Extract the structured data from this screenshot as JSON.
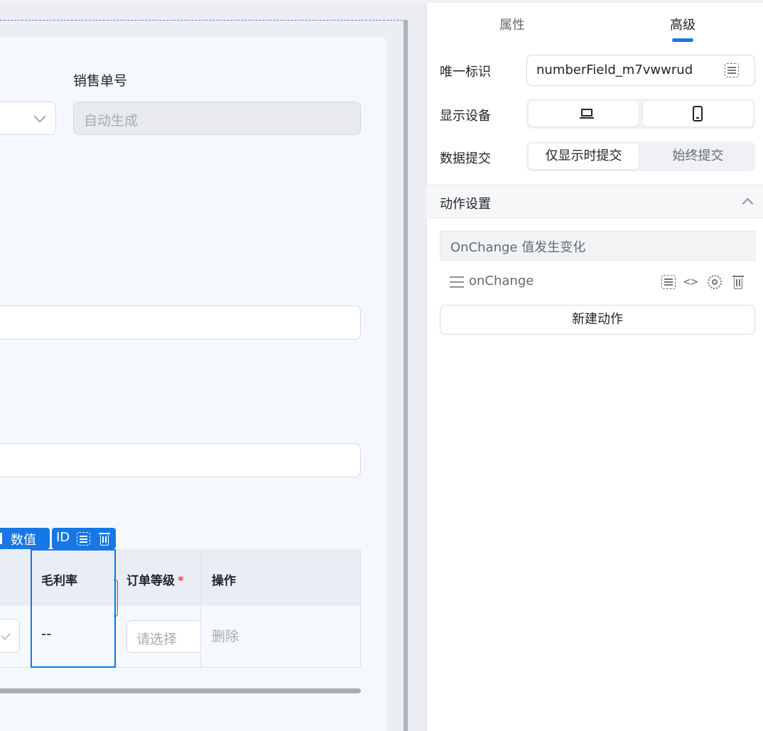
{
  "canvas": {
    "sale_no_label": "销售单号",
    "sale_no_placeholder": "自动生成",
    "component_tag": "数值",
    "component_id_label": "ID",
    "table": {
      "headers": [
        "毛利率",
        "订单等级",
        "操作"
      ],
      "required_mark": "*",
      "row": {
        "gross_margin": "--",
        "order_level_placeholder": "请选择",
        "action": "删除"
      }
    }
  },
  "panel": {
    "tabs": [
      "属性",
      "高级"
    ],
    "active_tab": "高级",
    "unique_id_label": "唯一标识",
    "unique_id_value": "numberField_m7vwwrud",
    "display_device_label": "显示设备",
    "devices": [
      "laptop-icon",
      "phone-icon"
    ],
    "data_submit_label": "数据提交",
    "submit_options": [
      "仅显示时提交",
      "始终提交"
    ],
    "submit_selected": "仅显示时提交",
    "action_section_title": "动作设置",
    "event_name": "OnChange 值发生变化",
    "action_name": "onChange",
    "code_symbol": "<>",
    "new_action_label": "新建动作"
  },
  "colors": {
    "accent": "#1677e5",
    "required": "#e5484d",
    "canvas_bg": "#eceef3",
    "form_bg": "#f5f8fc"
  }
}
